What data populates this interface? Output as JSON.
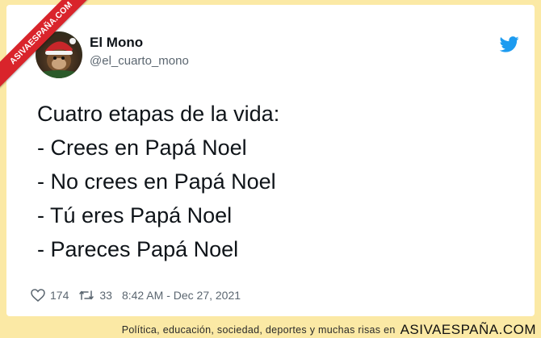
{
  "watermark": {
    "ribbon_text": "ASIVAESPAÑA.COM"
  },
  "tweet": {
    "author_name": "El Mono",
    "handle": "@el_cuarto_mono",
    "lines": [
      "Cuatro etapas de la vida:",
      "- Crees en Papá Noel",
      "- No crees en Papá Noel",
      "- Tú eres Papá Noel",
      "- Pareces Papá Noel"
    ],
    "likes": "174",
    "retweets": "33",
    "timestamp": "8:42 AM - Dec 27, 2021"
  },
  "icons": {
    "bird": "twitter-bird-icon",
    "like": "heart-icon",
    "retweet": "retweet-icon"
  },
  "footer": {
    "text": "Política, educación, sociedad, deportes y muchas risas en",
    "brand": "ASIVAESPAÑA.COM"
  },
  "colors": {
    "background": "#fbe9a5",
    "card": "#ffffff",
    "twitter_blue": "#1d9bf0",
    "ribbon": "#d9242b"
  }
}
